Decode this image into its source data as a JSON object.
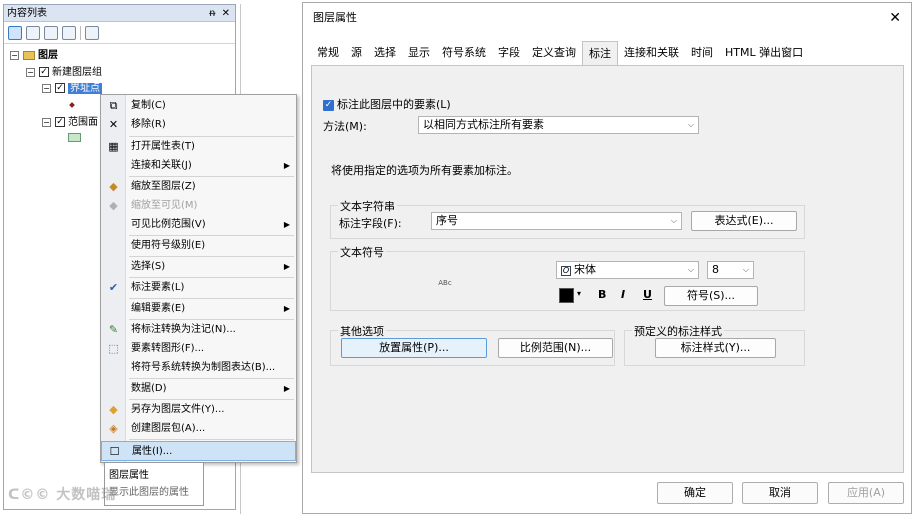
{
  "toc": {
    "title": "内容列表",
    "pin": "ᵰ",
    "close": "✕",
    "tree": {
      "layers_root": "图层",
      "group": "新建图层组",
      "layer1": "界址点",
      "layer2": "范围面"
    }
  },
  "context_menu": {
    "items": [
      {
        "label": "复制(C)",
        "icon": "copy-icon"
      },
      {
        "label": "移除(R)",
        "icon": "remove-icon"
      },
      {
        "label": "打开属性表(T)",
        "icon": "table-icon"
      },
      {
        "label": "连接和关联(J)",
        "icon": "",
        "submenu": true
      },
      {
        "label": "缩放至图层(Z)",
        "icon": "zoom-layer-icon"
      },
      {
        "label": "缩放至可见(M)",
        "icon": "zoom-visible-icon",
        "disabled": true
      },
      {
        "label": "可见比例范围(V)",
        "icon": "",
        "submenu": true
      },
      {
        "label": "使用符号级别(E)",
        "icon": ""
      },
      {
        "label": "选择(S)",
        "icon": "",
        "submenu": true
      },
      {
        "label": "标注要素(L)",
        "icon": "check-icon",
        "checked": true
      },
      {
        "label": "编辑要素(E)",
        "icon": "",
        "submenu": true
      },
      {
        "label": "将标注转换为注记(N)...",
        "icon": "annotation-icon"
      },
      {
        "label": "要素转图形(F)...",
        "icon": "graphic-icon"
      },
      {
        "label": "将符号系统转换为制图表达(B)...",
        "icon": ""
      },
      {
        "label": "数据(D)",
        "icon": "",
        "submenu": true
      },
      {
        "label": "另存为图层文件(Y)...",
        "icon": "layer-file-icon"
      },
      {
        "label": "创建图层包(A)...",
        "icon": "package-icon"
      },
      {
        "label": "属性(I)...",
        "icon": "properties-icon",
        "highlighted": true
      }
    ]
  },
  "tooltip": {
    "title": "图层属性",
    "desc": "显示此图层的属性"
  },
  "watermark": "大数喵瑞",
  "dialog": {
    "title": "图层属性",
    "close": "✕",
    "tabs": [
      "常规",
      "源",
      "选择",
      "显示",
      "符号系统",
      "字段",
      "定义查询",
      "标注",
      "连接和关联",
      "时间",
      "HTML 弹出窗口"
    ],
    "active_tab": "标注",
    "label_checkbox": "标注此图层中的要素(L)",
    "method_label": "方法(M):",
    "method_value": "以相同方式标注所有要素",
    "info": "将使用指定的选项为所有要素加标注。",
    "text_string": {
      "group": "文本字符串",
      "field_label": "标注字段(F):",
      "field_value": "序号",
      "expr_button": "表达式(E)..."
    },
    "text_symbol": {
      "group": "文本符号",
      "preview": "ABc",
      "font": "宋体",
      "size": "8",
      "bold": "B",
      "italic": "I",
      "underline": "U",
      "symbol_button": "符号(S)...",
      "color": "#000000"
    },
    "other": {
      "group": "其他选项",
      "placement_button": "放置属性(P)...",
      "scale_button": "比例范围(N)..."
    },
    "predefined": {
      "group": "预定义的标注样式",
      "style_button": "标注样式(Y)..."
    },
    "footer": {
      "ok": "确定",
      "cancel": "取消",
      "apply": "应用(A)"
    }
  }
}
